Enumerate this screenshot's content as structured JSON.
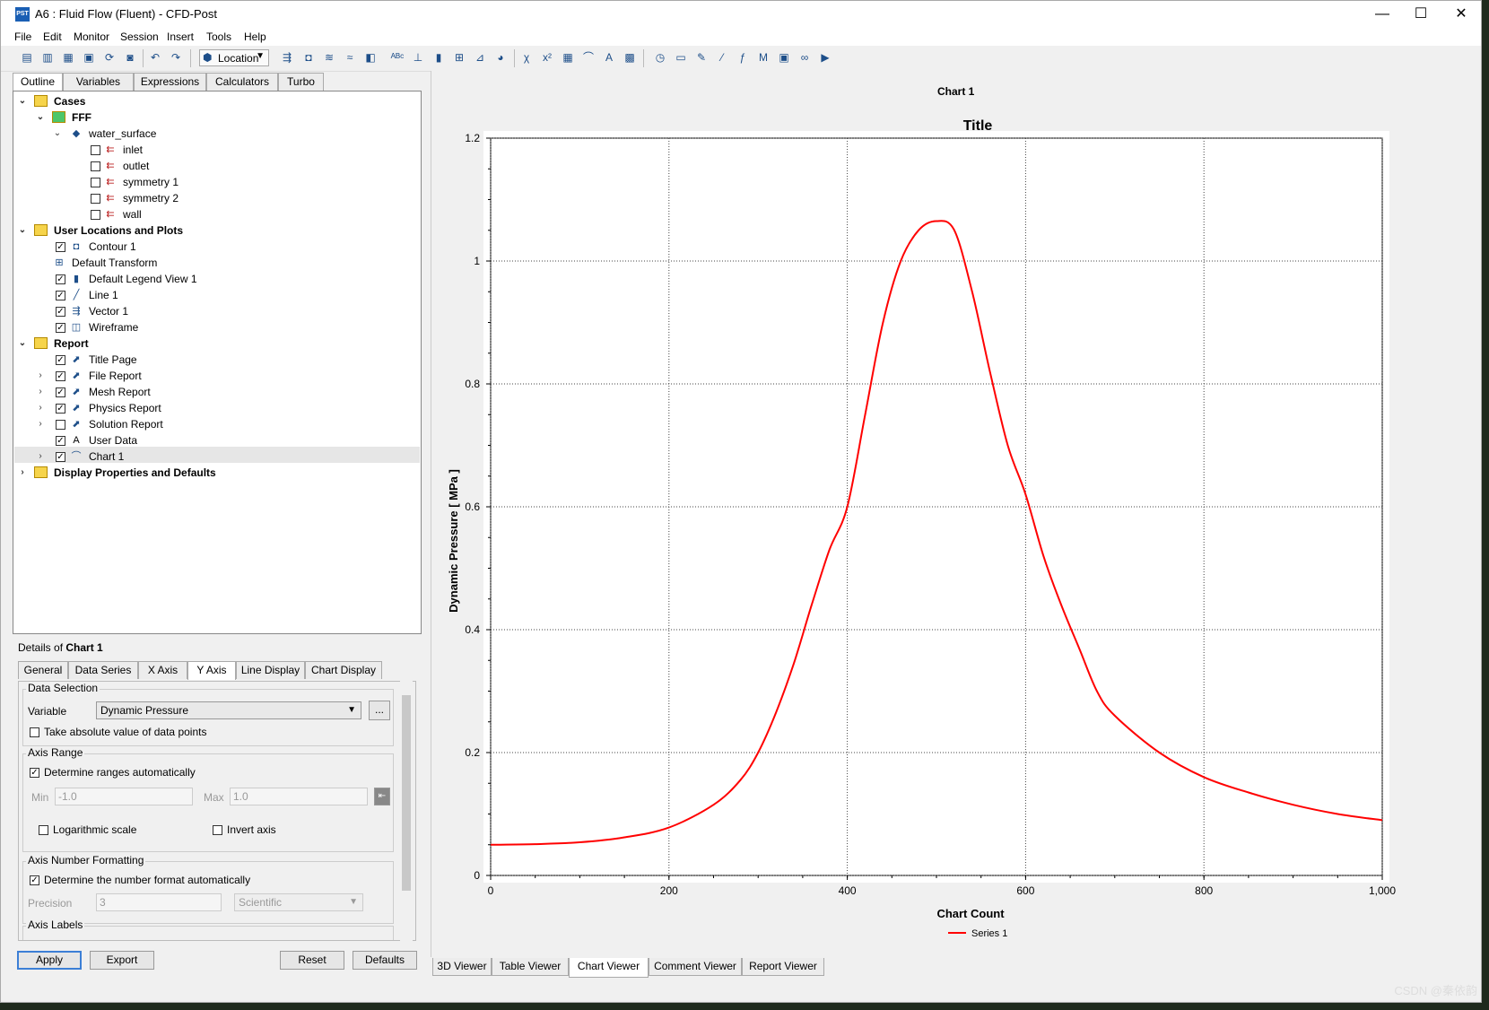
{
  "window": {
    "title": "A6 : Fluid Flow (Fluent) - CFD-Post",
    "app_icon_text": "PST",
    "minimize": "—",
    "maximize": "☐",
    "close": "✕"
  },
  "menu": [
    "File",
    "Edit",
    "Monitor",
    "Session",
    "Insert",
    "Tools",
    "Help"
  ],
  "toolbar": {
    "location_label": "Location"
  },
  "left_tabs": [
    "Outline",
    "Variables",
    "Expressions",
    "Calculators",
    "Turbo"
  ],
  "tree": {
    "cases": "Cases",
    "fff": "FFF",
    "water_surface": "water_surface",
    "boundaries": [
      "inlet",
      "outlet",
      "symmetry 1",
      "symmetry 2",
      "wall"
    ],
    "user_locations": "User Locations and Plots",
    "contour": "Contour 1",
    "default_transform": "Default Transform",
    "legend": "Default Legend View 1",
    "line": "Line 1",
    "vector": "Vector 1",
    "wireframe": "Wireframe",
    "report": "Report",
    "title_page": "Title Page",
    "file_report": "File Report",
    "mesh_report": "Mesh Report",
    "physics_report": "Physics Report",
    "solution_report": "Solution Report",
    "user_data": "User Data",
    "chart": "Chart 1",
    "display_props": "Display Properties and Defaults"
  },
  "details": {
    "prefix": "Details of",
    "object": "Chart 1",
    "tabs": [
      "General",
      "Data Series",
      "X Axis",
      "Y Axis",
      "Line Display",
      "Chart Display"
    ],
    "data_selection": "Data Selection",
    "variable_label": "Variable",
    "variable_value": "Dynamic Pressure",
    "more_button": "...",
    "abs_value": "Take absolute value of data points",
    "axis_range": "Axis Range",
    "determine_ranges": "Determine ranges automatically",
    "min_label": "Min",
    "min_value": "-1.0",
    "max_label": "Max",
    "max_value": "1.0",
    "log_scale": "Logarithmic scale",
    "invert_axis": "Invert axis",
    "number_formatting": "Axis Number Formatting",
    "determine_format": "Determine the number format automatically",
    "precision_label": "Precision",
    "precision_value": "3",
    "format_value": "Scientific",
    "axis_labels": "Axis Labels"
  },
  "buttons": {
    "apply": "Apply",
    "export": "Export",
    "reset": "Reset",
    "defaults": "Defaults"
  },
  "viewer_tabs": [
    "3D Viewer",
    "Table Viewer",
    "Chart Viewer",
    "Comment Viewer",
    "Report Viewer"
  ],
  "chart_header": "Chart 1",
  "watermark": "CSDN @秦依韵",
  "chart_data": {
    "type": "line",
    "title": "Title",
    "xlabel": "Chart Count",
    "ylabel": "Dynamic Pressure [ MPa ]",
    "xlim": [
      0,
      1000
    ],
    "ylim": [
      0,
      1.2
    ],
    "xticks": [
      "0",
      "200",
      "400",
      "600",
      "800",
      "1,000"
    ],
    "yticks": [
      "0",
      "0.2",
      "0.4",
      "0.6",
      "0.8",
      "1",
      "1.2"
    ],
    "grid": true,
    "legend_position": "bottom",
    "series": [
      {
        "name": "Series 1",
        "color": "#ff0000",
        "x": [
          0,
          50,
          100,
          150,
          200,
          250,
          280,
          300,
          320,
          340,
          360,
          380,
          400,
          420,
          440,
          460,
          480,
          500,
          520,
          540,
          560,
          580,
          600,
          620,
          640,
          660,
          680,
          700,
          750,
          800,
          850,
          900,
          950,
          1000
        ],
        "y": [
          0.05,
          0.051,
          0.054,
          0.062,
          0.078,
          0.115,
          0.155,
          0.2,
          0.265,
          0.345,
          0.44,
          0.53,
          0.6,
          0.75,
          0.9,
          1.0,
          1.05,
          1.065,
          1.05,
          0.95,
          0.82,
          0.7,
          0.62,
          0.52,
          0.44,
          0.37,
          0.3,
          0.26,
          0.2,
          0.16,
          0.135,
          0.115,
          0.1,
          0.09
        ]
      }
    ]
  }
}
